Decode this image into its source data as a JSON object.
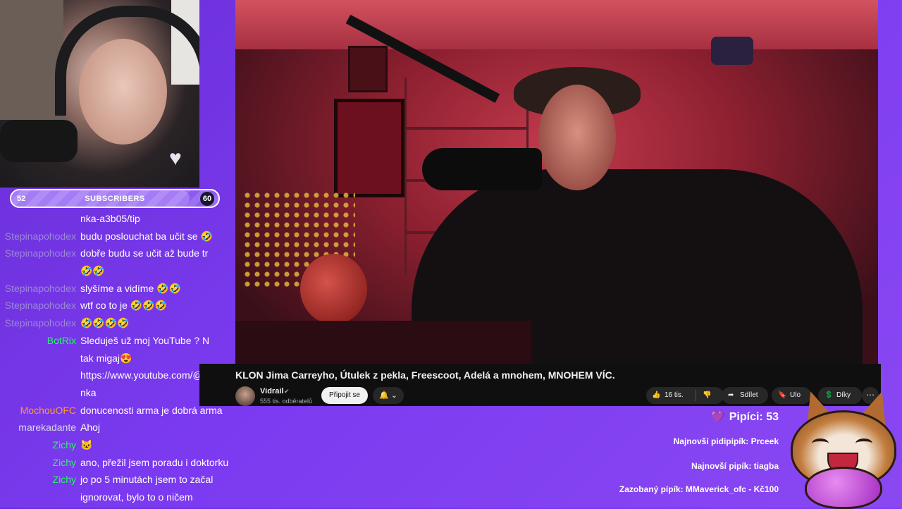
{
  "subscriber_bar": {
    "start": "52",
    "label": "SUBSCRIBERS",
    "goal": "60",
    "progress_fraction": 0.86
  },
  "chat": [
    {
      "user": "",
      "message": "nka-a3b05/tip",
      "color": "#9c86d8",
      "dim": true
    },
    {
      "user": "Stepinapohodex",
      "message": "budu poslouchat ba učit se 🤣",
      "color": "#9c86d8",
      "dim": true
    },
    {
      "user": "Stepinapohodex",
      "message": "dobře budu se učit až bude tr",
      "color": "#9c86d8",
      "dim": true
    },
    {
      "user": "",
      "message": "🤣🤣",
      "color": "#9c86d8",
      "dim": true
    },
    {
      "user": "Stepinapohodex",
      "message": "slyšíme a vidíme 🤣🤣",
      "color": "#9c86d8",
      "dim": true
    },
    {
      "user": "Stepinapohodex",
      "message": "wtf co to je 🤣🤣🤣",
      "color": "#9c86d8",
      "dim": true
    },
    {
      "user": "Stepinapohodex",
      "message": "🤣🤣🤣🤣",
      "color": "#9c86d8",
      "dim": true
    },
    {
      "user": "BotRix",
      "message": "Sleduješ už moj YouTube ? N",
      "color": "#2df36a",
      "dim": false
    },
    {
      "user": "",
      "message": "tak migaj😍",
      "color": "#2df36a",
      "dim": false
    },
    {
      "user": "",
      "message": "https://www.youtube.com/@D",
      "color": "#2df36a",
      "dim": false
    },
    {
      "user": "",
      "message": "nka",
      "color": "#2df36a",
      "dim": false
    },
    {
      "user": "MochouOFC",
      "message": "donucenosti arma je dobrá arma",
      "color": "#ff9a2e",
      "dim": false
    },
    {
      "user": "marekadante",
      "message": "Ahoj",
      "color": "#d8d8f0",
      "dim": false
    },
    {
      "user": "Zichy",
      "message": "🐱",
      "color": "#2df36a",
      "dim": false
    },
    {
      "user": "Zichy",
      "message": "ano, přežil jsem poradu i doktorku",
      "color": "#2df36a",
      "dim": false
    },
    {
      "user": "Zichy",
      "message": "jo po 5 minutách jsem to začal",
      "color": "#2df36a",
      "dim": false
    },
    {
      "user": "",
      "message": "ignorovat, bylo to o ničem",
      "color": "#2df36a",
      "dim": false
    }
  ],
  "video": {
    "title": "KLON Jima Carreyho, Útulek z pekla, Freescoot, Adelá a mnohem, MNOHEM VÍC.",
    "channel_name": "Vidrail",
    "verified_icon": "verified-icon",
    "subscribers": "555 tis. odběratelů",
    "join_label": "Připojit se",
    "bell_icon": "🔔",
    "bell_caret": "⌄",
    "likes": "16 tis.",
    "like_icon": "👍",
    "dislike_icon": "👎",
    "share_icon": "➦",
    "share_label": "Sdílet",
    "save_icon": "🔖",
    "save_label": "Ulo",
    "thanks_icon": "💲",
    "thanks_label": "Díky",
    "more_icon": "⋯"
  },
  "stats": {
    "heart_icon": "💜",
    "pipici": "Pipíci: 53",
    "pidipipik": "Najnovší pidipipík: Prceek",
    "pipik": "Najnovší pipík: tiagba",
    "zazobany": "Zazobaný pípík: MMaverick_ofc - Kč100"
  }
}
